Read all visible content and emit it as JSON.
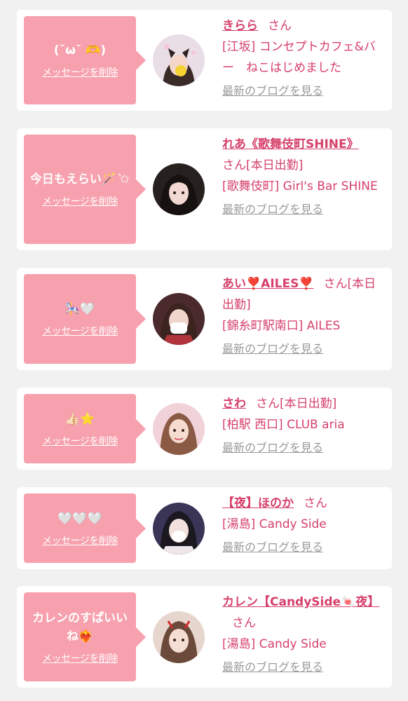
{
  "delete_label": "メッセージを削除",
  "blog_label": "最新のブログを見る",
  "san_label": "さん",
  "cards": [
    {
      "message": "(˘ω˘ 🫶)",
      "name": "きらら",
      "area": "[江坂] コンセプトカフェ&バー　ねこはじめました",
      "status": ""
    },
    {
      "message": "今日もえらい🪄 ͛✩",
      "name": "れあ《歌舞伎町SHINE》",
      "area": "[歌舞伎町] Girl's Bar SHINE",
      "status": "[本日出勤]"
    },
    {
      "message": "🎠🤍",
      "name": "あい❣️AILES❣️",
      "area": "[錦糸町駅南口] AILES",
      "status": "[本日出勤]"
    },
    {
      "message": "👍🏻⭐",
      "name": "さわ",
      "area": "[柏駅 西口] CLUB aria",
      "status": "[本日出勤]"
    },
    {
      "message": "🤍🤍🤍",
      "name": "【夜】ほのか",
      "area": "[湯島] Candy Side",
      "status": ""
    },
    {
      "message": "カレンのすぱいいね❤️‍🔥",
      "name": "カレン【CandySide🍬夜】",
      "area": "[湯島] Candy Side",
      "status": ""
    }
  ]
}
